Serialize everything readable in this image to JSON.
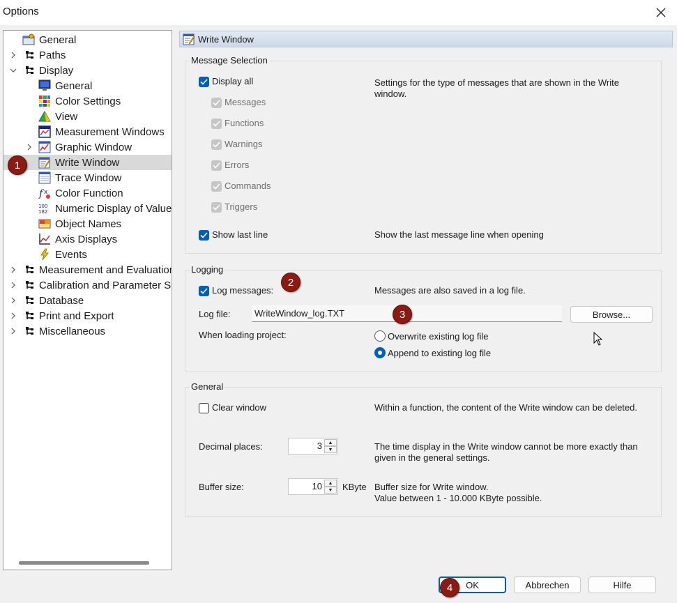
{
  "window": {
    "title": "Options"
  },
  "tree": {
    "items": [
      {
        "label": "General",
        "icon": "general-settings-icon"
      },
      {
        "label": "Paths",
        "icon": "folder-tree-icon"
      },
      {
        "label": "Display",
        "icon": "folder-tree-icon"
      },
      {
        "label": "General",
        "icon": "monitor-icon"
      },
      {
        "label": "Color Settings",
        "icon": "color-grid-icon"
      },
      {
        "label": "View",
        "icon": "view-icon"
      },
      {
        "label": "Measurement Windows",
        "icon": "measurement-windows-icon"
      },
      {
        "label": "Graphic Window",
        "icon": "graphic-window-icon"
      },
      {
        "label": "Write Window",
        "icon": "write-window-icon"
      },
      {
        "label": "Trace Window",
        "icon": "trace-window-icon"
      },
      {
        "label": "Color Function",
        "icon": "color-function-icon"
      },
      {
        "label": "Numeric Display of Values",
        "icon": "numeric-display-icon"
      },
      {
        "label": "Object Names",
        "icon": "object-names-icon"
      },
      {
        "label": "Axis Displays",
        "icon": "axis-displays-icon"
      },
      {
        "label": "Events",
        "icon": "lightning-icon"
      },
      {
        "label": "Measurement and Evaluation",
        "icon": "folder-tree-icon"
      },
      {
        "label": "Calibration and Parameter Sets",
        "icon": "folder-tree-icon"
      },
      {
        "label": "Database",
        "icon": "folder-tree-icon"
      },
      {
        "label": "Print and Export",
        "icon": "folder-tree-icon"
      },
      {
        "label": "Miscellaneous",
        "icon": "folder-tree-icon"
      }
    ]
  },
  "panel": {
    "header": "Write Window",
    "message_selection": {
      "title": "Message Selection",
      "display_all": "Display all",
      "messages": "Messages",
      "functions": "Functions",
      "warnings": "Warnings",
      "errors": "Errors",
      "commands": "Commands",
      "triggers": "Triggers",
      "show_last_line": "Show last line",
      "desc_settings": "Settings for the type of messages that are shown in the Write window.",
      "desc_last_line": "Show the last message line when opening"
    },
    "logging": {
      "title": "Logging",
      "log_messages": "Log messages:",
      "log_messages_desc": "Messages are also saved in a log file.",
      "log_file_label": "Log file:",
      "log_file_value": "WriteWindow_log.TXT",
      "browse": "Browse...",
      "when_loading": "When loading project:",
      "overwrite": "Overwrite existing log file",
      "append": "Append to existing log file"
    },
    "general": {
      "title": "General",
      "clear_window": "Clear window",
      "clear_desc": "Within a function, the content of the Write window can be deleted.",
      "decimal_label": "Decimal places:",
      "decimal_value": "3",
      "decimal_desc": "The time display in the Write window cannot be more exactly than given in the general settings.",
      "buffer_label": "Buffer size:",
      "buffer_value": "10",
      "buffer_unit": "KByte",
      "buffer_desc_1": "Buffer size for Write window.",
      "buffer_desc_2": "Value between 1 - 10.000 KByte possible."
    }
  },
  "buttons": {
    "ok": "OK",
    "cancel": "Abbrechen",
    "help": "Hilfe"
  },
  "callouts": [
    "1",
    "2",
    "3",
    "4"
  ]
}
